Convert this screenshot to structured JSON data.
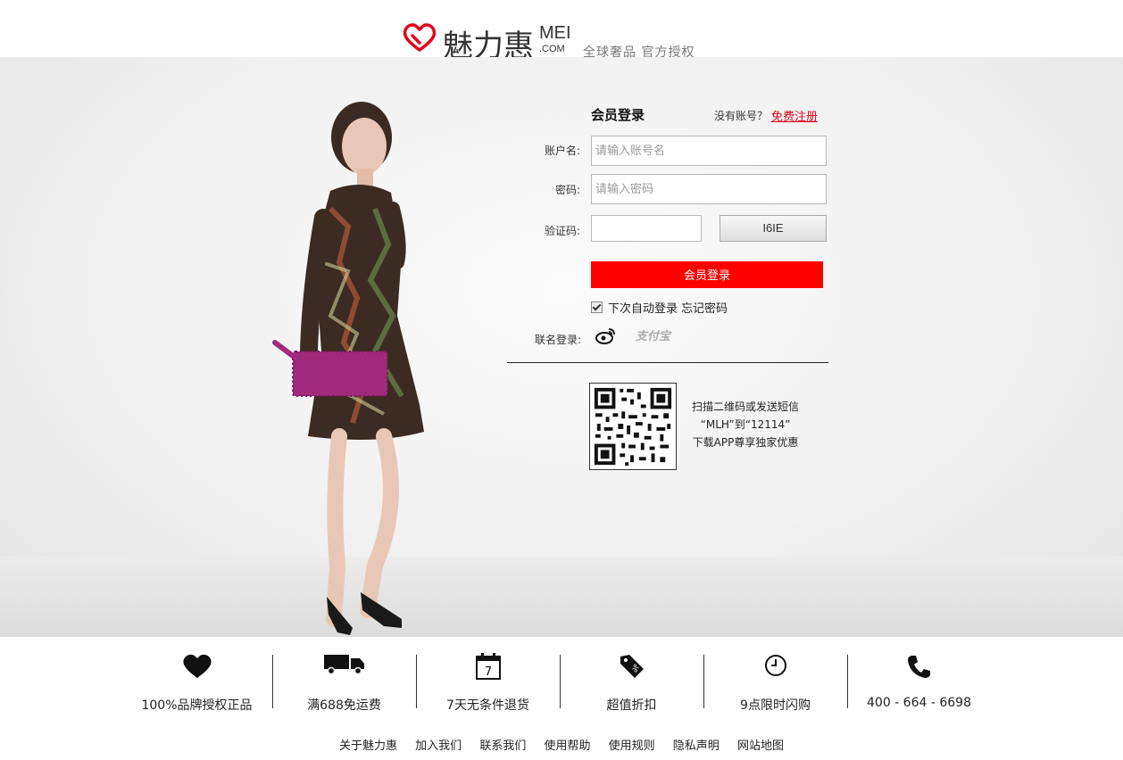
{
  "brand": {
    "name_cn": "魅力惠",
    "name_en": "MEI",
    "name_suffix": ".COM",
    "slogan": "全球奢品 官方授权",
    "accent": "#e3001b"
  },
  "login": {
    "title": "会员登录",
    "no_account": "没有账号？",
    "register_link": "免费注册",
    "username_label": "账户名:",
    "username_placeholder": "请输入账号名",
    "password_label": "密码:",
    "password_placeholder": "请输入密码",
    "captcha_label": "验证码:",
    "captcha_value": "",
    "captcha_image_text": "I6IE",
    "submit_label": "会员登录",
    "submit_color": "#ff0000",
    "remember_label": "下次自动登录",
    "remember_checked": true,
    "forgot_label": "忘记密码",
    "social_label": "联名登录:",
    "social": [
      {
        "name": "weibo",
        "icon": "weibo-icon"
      },
      {
        "name": "alipay",
        "label": "支付宝"
      }
    ]
  },
  "qr": {
    "lines": [
      "扫描二维码或发送短信",
      "“MLH”到“12114”",
      "下载APP尊享独家优惠"
    ]
  },
  "features": [
    {
      "icon": "heart-icon",
      "label": "100%品牌授权正品"
    },
    {
      "icon": "truck-icon",
      "label": "满688免运费"
    },
    {
      "icon": "calendar-icon",
      "label": "7天无条件退货",
      "icon_text": "7"
    },
    {
      "icon": "tag-icon",
      "label": "超值折扣"
    },
    {
      "icon": "clock-icon",
      "label": "9点限时闪购"
    },
    {
      "icon": "phone-icon",
      "label": "400 - 664 - 6698"
    }
  ],
  "footer_links": [
    "关于魅力惠",
    "加入我们",
    "联系我们",
    "使用帮助",
    "使用规则",
    "隐私声明",
    "网站地图"
  ]
}
